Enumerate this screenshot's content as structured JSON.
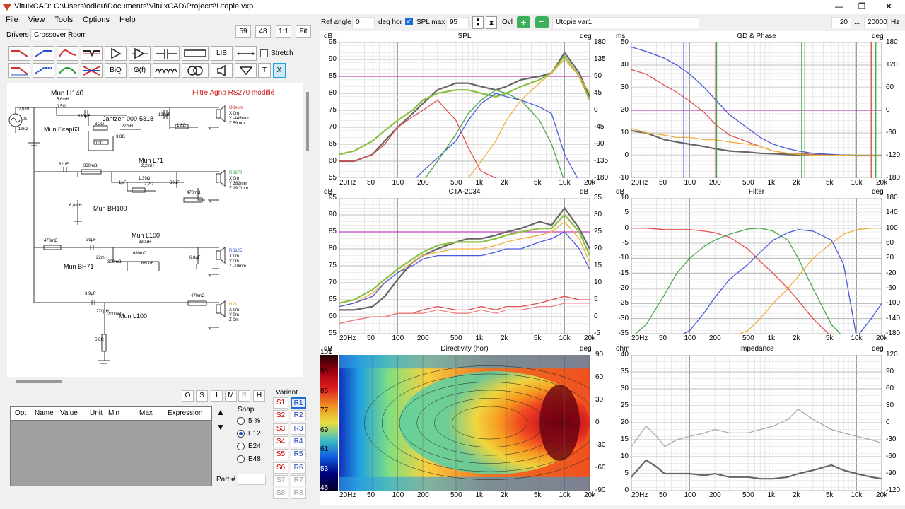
{
  "window": {
    "title": "VituixCAD: C:\\Users\\odieu\\Documents\\VituixCAD\\Projects\\Utopie.vxp"
  },
  "menu": [
    "File",
    "View",
    "Tools",
    "Options",
    "Help"
  ],
  "tabs": [
    "Drivers",
    "Crossover",
    "Room"
  ],
  "zoom": {
    "b1": "59",
    "b2": "48",
    "b3": "1:1",
    "b4": "Fit"
  },
  "tools": {
    "lib": "LIB",
    "stretch": "Stretch",
    "biq": "BiQ",
    "gf": "G(f)",
    "t": "T",
    "x": "X"
  },
  "schematic": {
    "title": "Filtre Agno RS270 modifié",
    "labels": [
      "Mun H140",
      "5,6mH",
      "0,5Ω",
      "22mH",
      "Jantzen 000-5318",
      "8,2Ω",
      "3,8Ω",
      "10Ω",
      "1,8Ω",
      "120µF",
      "330µF",
      "Mun Ecap63",
      "2,83V",
      "0s",
      "1mΩ",
      "Odeum",
      "X 0m",
      "Y -445mm",
      "Z 59mm",
      "Mun L71",
      "82µF",
      "330mΩ",
      "2,2mH",
      "1,39Ω",
      "1µF",
      "2,2Ω",
      "33µF",
      "470mΩ",
      "RS270",
      "X 0m",
      "Y 382mm",
      "Z 19,7mm",
      "6,8mH",
      "Mun BH100",
      "470mΩ",
      "39µF",
      "Mun L100",
      "330µH",
      "680mΩ",
      "680nF",
      "22mH",
      "300mΩ",
      "6,8µF",
      "RS125",
      "X 0m",
      "Y 0m",
      "Z -10mm",
      "Mun BH71",
      "3,9µF",
      "470mΩ",
      "HVI",
      "X 0m",
      "Y 0m",
      "Z 0m",
      "270µH",
      "200mΩ",
      "5,6Ω",
      "Mun L100"
    ]
  },
  "param_buttons": [
    "O",
    "S",
    "I",
    "M",
    "R",
    "H"
  ],
  "param_table": {
    "columns": [
      "Opt",
      "Name",
      "Value",
      "Unit",
      "Min",
      "Max",
      "Expression"
    ]
  },
  "snap": {
    "title": "Snap",
    "options": [
      "5 %",
      "E12",
      "E24",
      "E48"
    ],
    "selected": "E12"
  },
  "part": {
    "label": "Part #"
  },
  "variant": {
    "title": "Variant",
    "s": [
      "S1",
      "S2",
      "S3",
      "S4",
      "S5",
      "S6",
      "S7",
      "S8"
    ],
    "r": [
      "R1",
      "R2",
      "R3",
      "R4",
      "R5",
      "R6",
      "R7",
      "R8"
    ]
  },
  "top": {
    "ref_angle_label": "Ref angle",
    "ref_angle": "0",
    "deg_hor": "deg hor",
    "spl_max_label": "SPL max",
    "spl_max": "95",
    "ovl": "Ovl",
    "variant_name": "Utopie var1",
    "f_min": "20",
    "dots": "...",
    "f_max": "20000",
    "hz": "Hz"
  },
  "colors": {
    "red": "#e05050",
    "green": "#4aa84a",
    "blue": "#4a5ad8",
    "orange": "#f0b040",
    "grey": "#666666",
    "lime": "#8cc040",
    "magenta": "#c040c0",
    "nav": "#1840b8"
  },
  "freq_ticks": [
    "20Hz",
    "50",
    "100",
    "200",
    "500",
    "1k",
    "2k",
    "5k",
    "10k",
    "20k"
  ],
  "chart_data": [
    {
      "type": "line",
      "title": "SPL",
      "ylabel": "dB",
      "y2label": "deg",
      "ylim": [
        55,
        95
      ],
      "yticks": [
        "95",
        "90",
        "85",
        "80",
        "75",
        "70",
        "65",
        "60",
        "55"
      ],
      "y2ticks": [
        "180",
        "135",
        "90",
        "45",
        "0",
        "-45",
        "-90",
        "-135",
        "-180"
      ],
      "x": [
        20,
        30,
        50,
        70,
        100,
        150,
        200,
        300,
        500,
        700,
        1000,
        1500,
        2000,
        3000,
        5000,
        7000,
        10000,
        15000,
        20000
      ],
      "series": [
        {
          "color": "grey",
          "values": [
            60,
            60,
            62,
            66,
            70,
            74,
            77,
            81,
            83,
            83,
            82,
            81,
            82,
            84,
            85,
            86,
            92,
            86,
            79
          ]
        },
        {
          "color": "lime",
          "values": [
            62,
            63,
            66,
            69,
            72,
            75,
            78,
            80,
            81,
            81,
            80,
            79,
            80,
            82,
            84,
            86,
            91,
            85,
            78
          ]
        },
        {
          "color": "red",
          "values": [
            60,
            60,
            62,
            65,
            70,
            73,
            75,
            78,
            72,
            64,
            57,
            55,
            53,
            50,
            48,
            45,
            40,
            38,
            35
          ]
        },
        {
          "color": "blue",
          "values": [
            20,
            25,
            35,
            44,
            50,
            54,
            57,
            61,
            66,
            72,
            77,
            80,
            79,
            78,
            76,
            74,
            62,
            50,
            40
          ]
        },
        {
          "color": "green",
          "values": [
            10,
            18,
            30,
            40,
            45,
            48,
            52,
            60,
            68,
            74,
            78,
            81,
            80,
            78,
            72,
            65,
            54,
            45,
            35
          ]
        },
        {
          "color": "orange",
          "values": [
            10,
            15,
            20,
            25,
            30,
            35,
            40,
            45,
            50,
            55,
            60,
            66,
            72,
            78,
            83,
            86,
            90,
            85,
            80
          ]
        }
      ],
      "hline": 85
    },
    {
      "type": "line",
      "title": "GD & Phase",
      "ylabel": "ms",
      "y2label": "deg",
      "ylim": [
        -10,
        50
      ],
      "yticks": [
        "50",
        "40",
        "30",
        "20",
        "10",
        "0",
        "-10"
      ],
      "y2ticks": [
        "180",
        "120",
        "60",
        "0",
        "-60",
        "-120",
        "-180"
      ],
      "x": [
        20,
        30,
        50,
        70,
        100,
        150,
        200,
        300,
        500,
        700,
        1000,
        1500,
        2000,
        3000,
        5000,
        7000,
        10000,
        15000,
        20000
      ],
      "series": [
        {
          "color": "red",
          "values": [
            38,
            36,
            31,
            28,
            24,
            19,
            14,
            9,
            6,
            4,
            2,
            1,
            1,
            0.5,
            0.3,
            0.2,
            0.1,
            0.1,
            0
          ]
        },
        {
          "color": "blue",
          "values": [
            48,
            46,
            43,
            40,
            36,
            30,
            25,
            18,
            12,
            8,
            5,
            3,
            2,
            1,
            0.5,
            0.2,
            0.1,
            0,
            0
          ]
        },
        {
          "color": "grey",
          "values": [
            11,
            10,
            7,
            6,
            5,
            4,
            3,
            2,
            1.5,
            1,
            0.8,
            0.5,
            0.3,
            0.2,
            0.1,
            0.1,
            0,
            0,
            0
          ]
        },
        {
          "color": "orange",
          "values": [
            12,
            10,
            9,
            8,
            8,
            7,
            7,
            6,
            5,
            4,
            2,
            1,
            0.5,
            0.2,
            0.1,
            0.1,
            0,
            0,
            0
          ]
        }
      ],
      "hline": 20
    },
    {
      "type": "line",
      "title": "CTA-2034",
      "ylabel": "dB",
      "y2label": "dB",
      "ylim": [
        55,
        95
      ],
      "yticks": [
        "95",
        "90",
        "85",
        "80",
        "75",
        "70",
        "65",
        "60",
        "55"
      ],
      "y2ticks": [
        "35",
        "30",
        "25",
        "20",
        "15",
        "10",
        "5",
        "0",
        "-5"
      ],
      "x": [
        20,
        30,
        50,
        70,
        100,
        150,
        200,
        300,
        500,
        700,
        1000,
        1500,
        2000,
        3000,
        5000,
        7000,
        10000,
        15000,
        20000
      ],
      "series": [
        {
          "color": "grey",
          "values": [
            62,
            62,
            63,
            66,
            71,
            76,
            78,
            80,
            82,
            83,
            83,
            84,
            85,
            86,
            88,
            87,
            92,
            86,
            80
          ]
        },
        {
          "color": "lime",
          "values": [
            64,
            65,
            68,
            71,
            74,
            77,
            79,
            81,
            82,
            82,
            82,
            83,
            84,
            85,
            86,
            86,
            90,
            85,
            78
          ]
        },
        {
          "color": "orange",
          "values": [
            63,
            64,
            67,
            70,
            73,
            76,
            78,
            79,
            80,
            80,
            80,
            81,
            82,
            83,
            84,
            85,
            88,
            83,
            76
          ]
        },
        {
          "color": "blue",
          "values": [
            63,
            64,
            66,
            70,
            73,
            75,
            77,
            78,
            78,
            78,
            78,
            79,
            80,
            80,
            82,
            83,
            85,
            80,
            74
          ]
        },
        {
          "color": "red",
          "values": [
            58,
            59,
            60,
            60,
            61,
            61,
            62,
            63,
            62,
            62,
            63,
            62,
            63,
            63,
            64,
            65,
            66,
            65,
            65
          ]
        },
        {
          "color": "#f08080",
          "values": [
            58,
            59,
            60,
            60,
            61,
            61,
            61,
            62,
            61,
            61,
            62,
            61,
            62,
            62,
            63,
            63,
            64,
            64,
            64
          ]
        }
      ],
      "hline": 85
    },
    {
      "type": "line",
      "title": "Filter",
      "ylabel": "dB",
      "y2label": "deg",
      "ylim": [
        -35,
        10
      ],
      "yticks": [
        "10",
        "5",
        "0",
        "-5",
        "-10",
        "-15",
        "-20",
        "-25",
        "-30",
        "-35"
      ],
      "y2ticks": [
        "180",
        "140",
        "100",
        "60",
        "20",
        "-20",
        "-60",
        "-100",
        "-140",
        "-180"
      ],
      "x": [
        20,
        30,
        50,
        70,
        100,
        150,
        200,
        300,
        500,
        700,
        1000,
        1500,
        2000,
        3000,
        5000,
        7000,
        10000,
        15000,
        20000
      ],
      "series": [
        {
          "color": "red",
          "values": [
            0,
            0,
            -0.5,
            -0.5,
            -0.5,
            -1,
            -1.5,
            -3,
            -7,
            -11,
            -15,
            -20,
            -24,
            -30,
            -36,
            -40,
            -44,
            -48,
            -50
          ]
        },
        {
          "color": "green",
          "values": [
            -40,
            -32,
            -22,
            -15,
            -10,
            -6,
            -4,
            -2,
            -0.3,
            0,
            -1,
            -4,
            -10,
            -20,
            -32,
            -40,
            -45,
            -45,
            -40
          ]
        },
        {
          "color": "blue",
          "values": [
            -70,
            -60,
            -48,
            -40,
            -34,
            -28,
            -23,
            -17,
            -12,
            -8,
            -4,
            -1.5,
            -0.5,
            -1,
            -4,
            -12,
            -40,
            -30,
            -25
          ]
        },
        {
          "color": "orange",
          "values": [
            -90,
            -82,
            -70,
            -62,
            -56,
            -50,
            -45,
            -40,
            -34,
            -30,
            -25,
            -20,
            -16,
            -10,
            -5,
            -2,
            -0.5,
            0,
            0
          ]
        }
      ]
    },
    {
      "type": "heatmap",
      "title": "Directivity (hor)",
      "ylabel": "dB",
      "y2label": "deg",
      "colorbar": [
        "101",
        "93",
        "85",
        "77",
        "69",
        "61",
        "53",
        "45"
      ],
      "y2ticks": [
        "90",
        "60",
        "30",
        "0",
        "-30",
        "-60",
        "-90"
      ]
    },
    {
      "type": "line",
      "title": "Impedance",
      "ylabel": "ohm",
      "y2label": "deg",
      "ylim": [
        0,
        40
      ],
      "yticks": [
        "40",
        "35",
        "30",
        "25",
        "20",
        "15",
        "10",
        "5",
        "0"
      ],
      "y2ticks": [
        "120",
        "90",
        "60",
        "30",
        "0",
        "-30",
        "-60",
        "-90",
        "-120"
      ],
      "x": [
        20,
        30,
        40,
        50,
        70,
        100,
        150,
        200,
        300,
        500,
        700,
        1000,
        1500,
        2000,
        3000,
        5000,
        7000,
        10000,
        15000,
        20000
      ],
      "series": [
        {
          "color": "#aaaaaa",
          "values": [
            13,
            19,
            16,
            13,
            15,
            16,
            17,
            18,
            17,
            17,
            18,
            19,
            21,
            24,
            21,
            18,
            17,
            16,
            15,
            14
          ]
        },
        {
          "color": "grey",
          "values": [
            4,
            9,
            7,
            5,
            5,
            5,
            4.5,
            5,
            4,
            4,
            3.5,
            3.5,
            4,
            5,
            6,
            7.5,
            6,
            5,
            4,
            3.5
          ]
        }
      ]
    }
  ]
}
